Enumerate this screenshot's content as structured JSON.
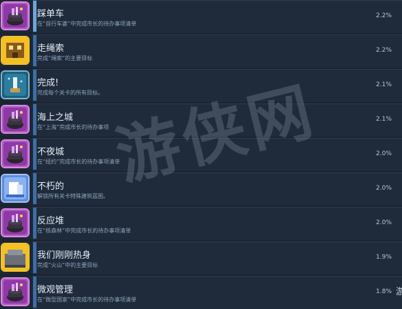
{
  "achievements": [
    {
      "title": "踩单车",
      "desc": "在“自行车婆”中完成市长的待办事项清单",
      "pct": "2.2%",
      "icon": "purple-cauldron-icon",
      "frame": "#d98be0"
    },
    {
      "title": "走绳索",
      "desc": "完成“绳索”的主要目标",
      "pct": "2.2%",
      "icon": "yellow-building-icon",
      "frame": "#f1c232"
    },
    {
      "title": "完成!",
      "desc": "完成每个关卡的所有目标。",
      "pct": "2.1%",
      "icon": "trophy-icon",
      "frame": "#7fb7d6"
    },
    {
      "title": "海上之城",
      "desc": "在“上海”完成市长的待办事项",
      "pct": "2.1%",
      "icon": "purple-cauldron-icon",
      "frame": "#d98be0"
    },
    {
      "title": "不夜城",
      "desc": "在“纽约”完成市长的待办事项清单",
      "pct": "2.0%",
      "icon": "purple-cauldron-icon",
      "frame": "#d98be0"
    },
    {
      "title": "不朽的",
      "desc": "解锁所有关卡特殊建筑蓝图。",
      "pct": "2.0%",
      "icon": "blueprint-icon",
      "frame": "#a9c4f0"
    },
    {
      "title": "反应堆",
      "desc": "在“核森林”中完成市长的待办事项清单",
      "pct": "2.0%",
      "icon": "purple-cauldron-icon",
      "frame": "#d98be0"
    },
    {
      "title": "我们刚刚热身",
      "desc": "完成“火山”中的主要目标",
      "pct": "1.9%",
      "icon": "yellow-volcano-building-icon",
      "frame": "#f1c232"
    },
    {
      "title": "微观管理",
      "desc": "在“微型国家”中完成市长的待办事项清单",
      "pct": "1.8%",
      "icon": "purple-cauldron-icon",
      "frame": "#d98be0"
    }
  ],
  "watermark": "游侠网",
  "edge_text": "游"
}
